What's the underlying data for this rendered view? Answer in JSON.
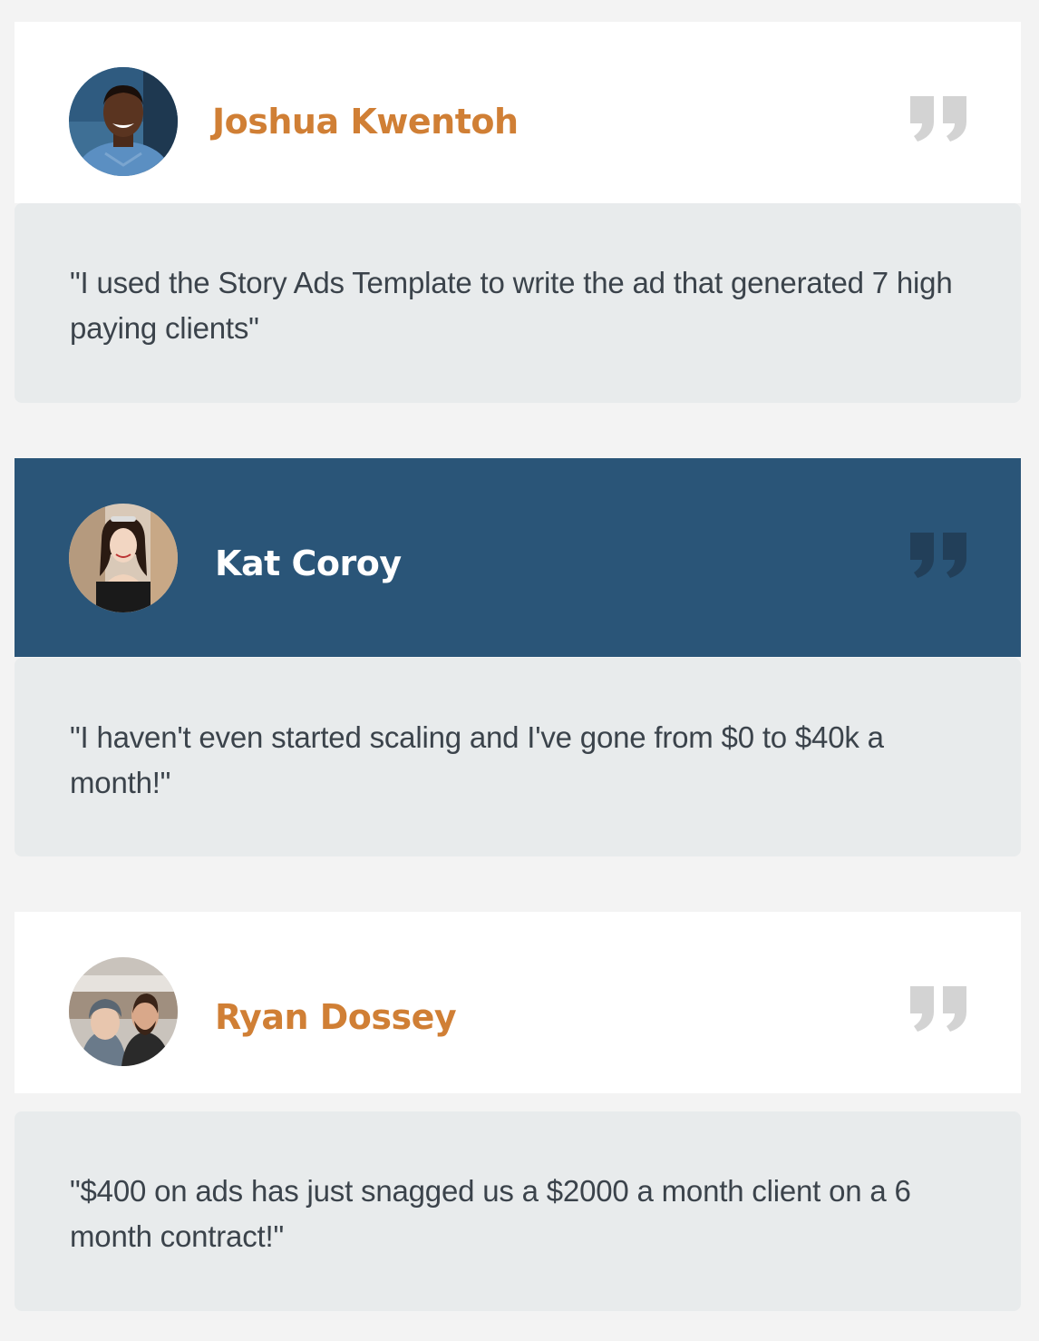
{
  "colors": {
    "page_background": "#f3f3f3",
    "card_background": "#ffffff",
    "highlight_card_background": "#2a5578",
    "quote_body_background": "#e8ebec",
    "name_accent": "#d07f35",
    "name_on_dark": "#ffffff",
    "quote_text": "#3b434b",
    "quote_icon_light": "#d3d3d3",
    "quote_icon_dark": "#223f59"
  },
  "testimonials": [
    {
      "name": "Joshua Kwentoh",
      "avatar_icon": "avatar-photo",
      "quote_icon": "quote-mark-icon",
      "quote": "\"I used the Story Ads Template to write the ad that generated 7 high paying clients\""
    },
    {
      "name": "Kat Coroy",
      "avatar_icon": "avatar-photo",
      "quote_icon": "quote-mark-icon",
      "quote": "\"I haven't even started scaling and I've gone from $0 to $40k a month!\""
    },
    {
      "name": "Ryan Dossey",
      "avatar_icon": "avatar-photo",
      "quote_icon": "quote-mark-icon",
      "quote": "\"$400 on ads has just snagged us a $2000 a month client on a 6 month contract!\""
    }
  ]
}
